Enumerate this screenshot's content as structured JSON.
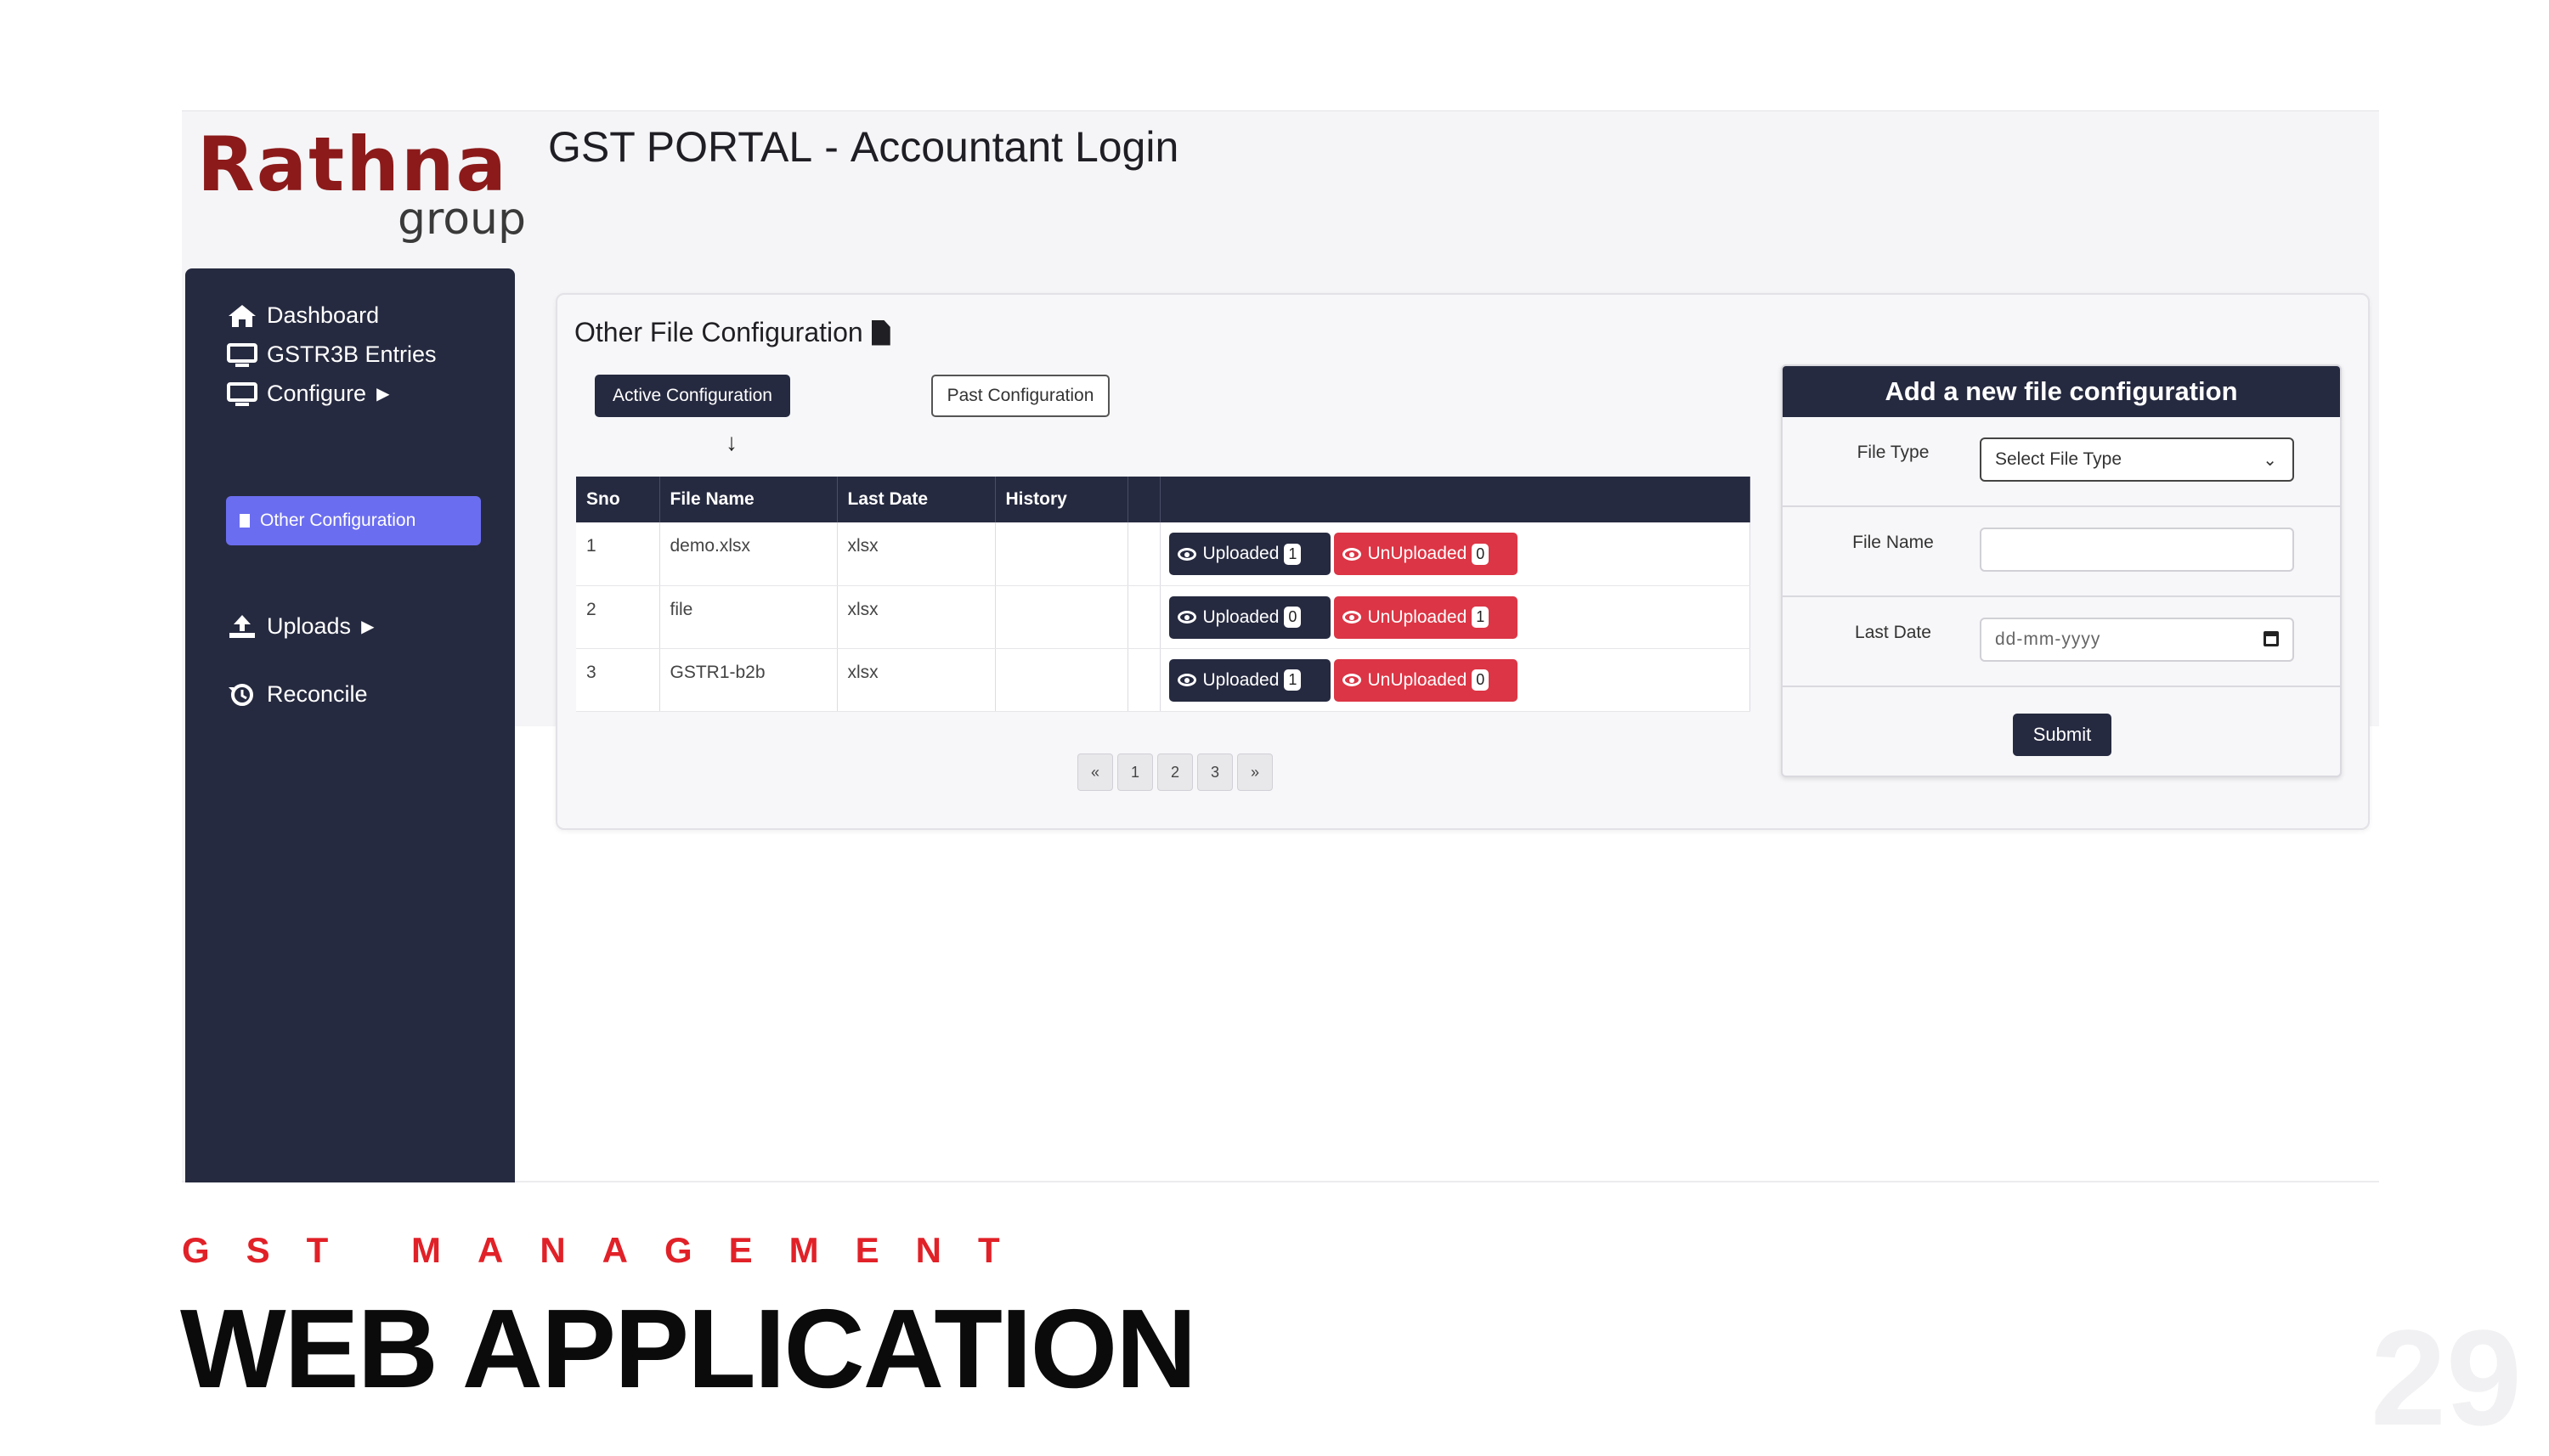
{
  "brand": {
    "logo_word": "Rathna",
    "logo_sub": "group",
    "accent_color": "#8c1a1a"
  },
  "header": {
    "portal": "GST PORTAL",
    "separator": "-",
    "role": "Accountant Login"
  },
  "sidebar": {
    "items": [
      {
        "label": "Dashboard",
        "icon": "home-icon"
      },
      {
        "label": "GSTR3B Entries",
        "icon": "monitor-icon"
      },
      {
        "label": "Configure",
        "icon": "monitor-icon"
      },
      {
        "label": "Uploads",
        "icon": "upload-icon"
      },
      {
        "label": "Reconcile",
        "icon": "history-icon"
      }
    ],
    "sub_item": {
      "label": "Other Configuration",
      "icon": "document-icon"
    }
  },
  "main": {
    "title": "Other File Configuration",
    "tabs": {
      "active": "Active Configuration",
      "past": "Past Configuration"
    },
    "table": {
      "headers": [
        "Sno",
        "File Name",
        "Last Date",
        "History",
        ""
      ],
      "rows": [
        {
          "sno": "1",
          "name": "demo.xlsx",
          "date": "xlsx",
          "history": "",
          "uploaded": "1",
          "unuploaded": "0"
        },
        {
          "sno": "2",
          "name": "file",
          "date": "xlsx",
          "history": "",
          "uploaded": "0",
          "unuploaded": "1"
        },
        {
          "sno": "3",
          "name": "GSTR1-b2b",
          "date": "xlsx",
          "history": "",
          "uploaded": "1",
          "unuploaded": "0"
        }
      ],
      "uploaded_label": "Uploaded",
      "unuploaded_label": "UnUploaded"
    },
    "pagination": [
      "«",
      "1",
      "2",
      "3",
      "»"
    ]
  },
  "form": {
    "heading": "Add a new file configuration",
    "file_type_label": "File Type",
    "file_type_value": "Select File Type",
    "file_name_label": "File Name",
    "file_name_value": "",
    "last_date_label": "Last Date",
    "last_date_placeholder": "dd-mm-yyyy",
    "submit": "Submit"
  },
  "slide": {
    "kicker": "GST MANAGEMENT",
    "headline": "WEB APPLICATION",
    "page_number": "29",
    "kicker_color": "#e12128"
  }
}
